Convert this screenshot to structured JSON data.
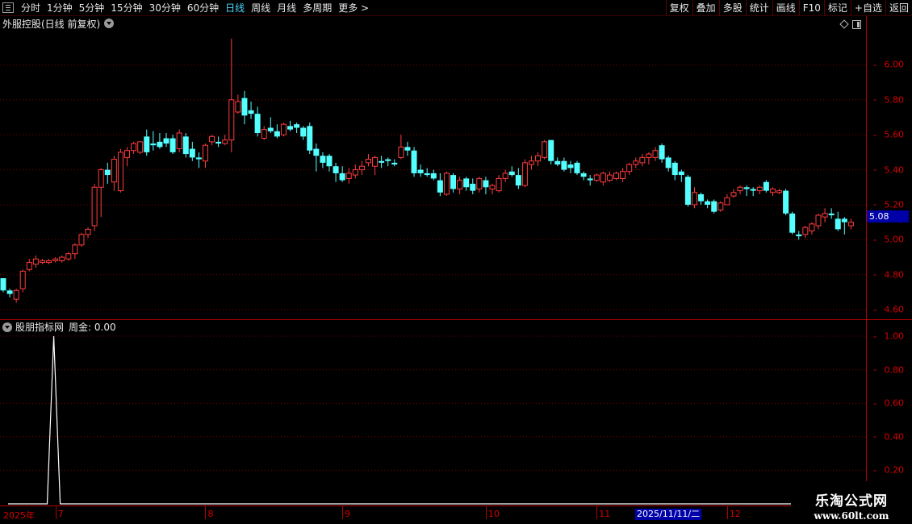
{
  "toolbar": {
    "periods": [
      {
        "label": "分时",
        "active": false
      },
      {
        "label": "1分钟",
        "active": false
      },
      {
        "label": "5分钟",
        "active": false
      },
      {
        "label": "15分钟",
        "active": false
      },
      {
        "label": "30分钟",
        "active": false
      },
      {
        "label": "60分钟",
        "active": false
      },
      {
        "label": "日线",
        "active": true
      },
      {
        "label": "周线",
        "active": false
      },
      {
        "label": "月线",
        "active": false
      },
      {
        "label": "多周期",
        "active": false
      },
      {
        "label": "更多 >",
        "active": false
      }
    ],
    "actions": [
      "复权",
      "叠加",
      "多股",
      "统计",
      "画线",
      "F10",
      "标记",
      "+自选",
      "返回"
    ]
  },
  "stock": {
    "title": "外服控股(日线 前复权)",
    "current_price": "5.08"
  },
  "indicator": {
    "name": "股朋指标网",
    "line_label": "周金: 0.00"
  },
  "dates": {
    "labels": [
      "2025年",
      "7",
      "8",
      "9",
      "10",
      "11",
      "12"
    ],
    "highlight": "2025/11/11/二"
  },
  "watermark": {
    "line1": "乐淘公式网",
    "line2": "www.60lt.com"
  },
  "colors": {
    "up": "#ff3c3c",
    "down": "#54ffff",
    "axis": "#d80000",
    "grid": "#7a0000",
    "indicator_line": "#ffffff"
  },
  "chart_data": [
    {
      "type": "candlestick",
      "title": "外服控股(日线 前复权)",
      "ylim": [
        4.55,
        6.2
      ],
      "yticks": [
        "6.00",
        "5.80",
        "5.60",
        "5.40",
        "5.20",
        "5.00",
        "4.80",
        "4.60"
      ],
      "ohlc": [
        [
          4.78,
          4.78,
          4.7,
          4.71
        ],
        [
          4.71,
          4.72,
          4.67,
          4.69
        ],
        [
          4.66,
          4.72,
          4.64,
          4.71
        ],
        [
          4.72,
          4.83,
          4.7,
          4.82
        ],
        [
          4.83,
          4.89,
          4.82,
          4.87
        ],
        [
          4.86,
          4.91,
          4.84,
          4.89
        ],
        [
          4.87,
          4.89,
          4.86,
          4.88
        ],
        [
          4.87,
          4.89,
          4.86,
          4.88
        ],
        [
          4.88,
          4.9,
          4.87,
          4.89
        ],
        [
          4.88,
          4.91,
          4.87,
          4.9
        ],
        [
          4.89,
          4.93,
          4.88,
          4.92
        ],
        [
          4.92,
          4.98,
          4.89,
          4.97
        ],
        [
          4.97,
          5.04,
          4.96,
          5.03
        ],
        [
          5.03,
          5.07,
          5.01,
          5.06
        ],
        [
          5.08,
          5.32,
          5.05,
          5.3
        ],
        [
          5.3,
          5.41,
          5.13,
          5.4
        ],
        [
          5.4,
          5.44,
          5.32,
          5.37
        ],
        [
          5.33,
          5.48,
          5.28,
          5.46
        ],
        [
          5.28,
          5.52,
          5.27,
          5.5
        ],
        [
          5.47,
          5.53,
          5.42,
          5.51
        ],
        [
          5.51,
          5.56,
          5.49,
          5.55
        ],
        [
          5.5,
          5.56,
          5.49,
          5.56
        ],
        [
          5.59,
          5.63,
          5.48,
          5.5
        ],
        [
          5.55,
          5.62,
          5.51,
          5.54
        ],
        [
          5.56,
          5.61,
          5.52,
          5.53
        ],
        [
          5.58,
          5.61,
          5.53,
          5.55
        ],
        [
          5.58,
          5.6,
          5.49,
          5.5
        ],
        [
          5.52,
          5.63,
          5.5,
          5.61
        ],
        [
          5.59,
          5.61,
          5.47,
          5.49
        ],
        [
          5.52,
          5.56,
          5.45,
          5.47
        ],
        [
          5.47,
          5.5,
          5.41,
          5.46
        ],
        [
          5.45,
          5.55,
          5.41,
          5.54
        ],
        [
          5.56,
          5.6,
          5.54,
          5.59
        ],
        [
          5.56,
          5.59,
          5.53,
          5.55
        ],
        [
          5.55,
          5.6,
          5.54,
          5.57
        ],
        [
          5.57,
          6.15,
          5.5,
          5.8
        ],
        [
          5.73,
          5.83,
          5.72,
          5.79
        ],
        [
          5.81,
          5.85,
          5.66,
          5.71
        ],
        [
          5.74,
          5.79,
          5.69,
          5.72
        ],
        [
          5.72,
          5.76,
          5.59,
          5.61
        ],
        [
          5.58,
          5.65,
          5.57,
          5.63
        ],
        [
          5.64,
          5.7,
          5.61,
          5.62
        ],
        [
          5.62,
          5.66,
          5.58,
          5.59
        ],
        [
          5.6,
          5.67,
          5.59,
          5.66
        ],
        [
          5.65,
          5.68,
          5.62,
          5.63
        ],
        [
          5.66,
          5.67,
          5.61,
          5.64
        ],
        [
          5.64,
          5.65,
          5.57,
          5.59
        ],
        [
          5.65,
          5.67,
          5.49,
          5.51
        ],
        [
          5.52,
          5.55,
          5.39,
          5.48
        ],
        [
          5.48,
          5.5,
          5.41,
          5.44
        ],
        [
          5.48,
          5.49,
          5.39,
          5.42
        ],
        [
          5.42,
          5.44,
          5.33,
          5.38
        ],
        [
          5.38,
          5.42,
          5.33,
          5.34
        ],
        [
          5.35,
          5.41,
          5.32,
          5.38
        ],
        [
          5.37,
          5.43,
          5.35,
          5.4
        ],
        [
          5.4,
          5.45,
          5.37,
          5.42
        ],
        [
          5.44,
          5.49,
          5.42,
          5.46
        ],
        [
          5.42,
          5.48,
          5.37,
          5.47
        ],
        [
          5.45,
          5.48,
          5.41,
          5.44
        ],
        [
          5.46,
          5.47,
          5.42,
          5.45
        ],
        [
          5.44,
          5.46,
          5.42,
          5.43
        ],
        [
          5.47,
          5.6,
          5.46,
          5.53
        ],
        [
          5.53,
          5.56,
          5.48,
          5.51
        ],
        [
          5.51,
          5.53,
          5.36,
          5.38
        ],
        [
          5.4,
          5.43,
          5.36,
          5.38
        ],
        [
          5.38,
          5.41,
          5.36,
          5.37
        ],
        [
          5.38,
          5.4,
          5.34,
          5.35
        ],
        [
          5.34,
          5.38,
          5.25,
          5.27
        ],
        [
          5.26,
          5.39,
          5.25,
          5.38
        ],
        [
          5.37,
          5.38,
          5.27,
          5.29
        ],
        [
          5.29,
          5.36,
          5.26,
          5.34
        ],
        [
          5.35,
          5.36,
          5.28,
          5.3
        ],
        [
          5.32,
          5.35,
          5.26,
          5.28
        ],
        [
          5.29,
          5.36,
          5.27,
          5.35
        ],
        [
          5.34,
          5.36,
          5.26,
          5.3
        ],
        [
          5.29,
          5.32,
          5.26,
          5.31
        ],
        [
          5.28,
          5.37,
          5.27,
          5.35
        ],
        [
          5.35,
          5.4,
          5.33,
          5.38
        ],
        [
          5.39,
          5.42,
          5.36,
          5.37
        ],
        [
          5.37,
          5.41,
          5.29,
          5.31
        ],
        [
          5.31,
          5.46,
          5.3,
          5.44
        ],
        [
          5.43,
          5.48,
          5.4,
          5.45
        ],
        [
          5.45,
          5.5,
          5.42,
          5.48
        ],
        [
          5.47,
          5.57,
          5.46,
          5.56
        ],
        [
          5.57,
          5.57,
          5.43,
          5.45
        ],
        [
          5.45,
          5.47,
          5.42,
          5.43
        ],
        [
          5.45,
          5.47,
          5.39,
          5.4
        ],
        [
          5.43,
          5.45,
          5.38,
          5.41
        ],
        [
          5.44,
          5.45,
          5.37,
          5.38
        ],
        [
          5.38,
          5.39,
          5.34,
          5.36
        ],
        [
          5.35,
          5.37,
          5.31,
          5.34
        ],
        [
          5.34,
          5.38,
          5.33,
          5.37
        ],
        [
          5.33,
          5.39,
          5.31,
          5.38
        ],
        [
          5.34,
          5.39,
          5.33,
          5.37
        ],
        [
          5.35,
          5.39,
          5.34,
          5.38
        ],
        [
          5.35,
          5.41,
          5.33,
          5.39
        ],
        [
          5.39,
          5.44,
          5.37,
          5.43
        ],
        [
          5.43,
          5.47,
          5.41,
          5.45
        ],
        [
          5.44,
          5.49,
          5.42,
          5.47
        ],
        [
          5.47,
          5.5,
          5.43,
          5.49
        ],
        [
          5.47,
          5.53,
          5.45,
          5.51
        ],
        [
          5.54,
          5.55,
          5.44,
          5.46
        ],
        [
          5.47,
          5.48,
          5.39,
          5.41
        ],
        [
          5.44,
          5.45,
          5.34,
          5.37
        ],
        [
          5.39,
          5.4,
          5.33,
          5.37
        ],
        [
          5.36,
          5.37,
          5.19,
          5.2
        ],
        [
          5.2,
          5.3,
          5.18,
          5.27
        ],
        [
          5.26,
          5.27,
          5.2,
          5.22
        ],
        [
          5.22,
          5.23,
          5.18,
          5.2
        ],
        [
          5.22,
          5.23,
          5.15,
          5.16
        ],
        [
          5.17,
          5.22,
          5.16,
          5.21
        ],
        [
          5.2,
          5.26,
          5.2,
          5.24
        ],
        [
          5.25,
          5.29,
          5.24,
          5.27
        ],
        [
          5.28,
          5.31,
          5.26,
          5.3
        ],
        [
          5.3,
          5.31,
          5.25,
          5.29
        ],
        [
          5.29,
          5.3,
          5.25,
          5.28
        ],
        [
          5.28,
          5.31,
          5.26,
          5.3
        ],
        [
          5.33,
          5.34,
          5.27,
          5.28
        ],
        [
          5.27,
          5.3,
          5.25,
          5.29
        ],
        [
          5.27,
          5.29,
          5.26,
          5.28
        ],
        [
          5.28,
          5.29,
          5.14,
          5.15
        ],
        [
          5.15,
          5.16,
          5.03,
          5.04
        ],
        [
          5.03,
          5.05,
          5.0,
          5.02
        ],
        [
          5.03,
          5.08,
          5.01,
          5.07
        ],
        [
          5.05,
          5.1,
          5.03,
          5.09
        ],
        [
          5.08,
          5.15,
          5.06,
          5.14
        ],
        [
          5.13,
          5.18,
          5.1,
          5.15
        ],
        [
          5.15,
          5.18,
          5.12,
          5.14
        ],
        [
          5.12,
          5.16,
          5.05,
          5.06
        ],
        [
          5.12,
          5.13,
          5.03,
          5.1
        ],
        [
          5.08,
          5.12,
          5.06,
          5.1
        ]
      ]
    },
    {
      "type": "line",
      "title": "股朋指标网",
      "series": [
        {
          "name": "周金",
          "values": [
            0,
            0,
            0,
            0,
            0,
            0,
            0,
            1,
            0,
            0,
            0,
            0,
            0,
            0,
            0,
            0,
            0,
            0,
            0,
            0,
            0,
            0,
            0,
            0,
            0,
            0,
            0,
            0,
            0,
            0,
            0,
            0,
            0,
            0,
            0,
            0,
            0,
            0,
            0,
            0,
            0,
            0,
            0,
            0,
            0,
            0,
            0,
            0,
            0,
            0,
            0,
            0,
            0,
            0,
            0,
            0,
            0,
            0,
            0,
            0,
            0,
            0,
            0,
            0,
            0,
            0,
            0,
            0,
            0,
            0,
            0,
            0,
            0,
            0,
            0,
            0,
            0,
            0,
            0,
            0,
            0,
            0,
            0,
            0,
            0,
            0,
            0,
            0,
            0,
            0,
            0,
            0,
            0,
            0,
            0,
            0,
            0,
            0,
            0,
            0,
            0,
            0,
            0,
            0,
            0,
            0,
            0,
            0,
            0,
            0,
            0,
            0,
            0,
            0,
            0,
            0,
            0,
            0,
            0,
            0,
            0,
            0,
            0,
            0,
            0,
            0,
            0,
            0,
            0,
            0,
            0
          ]
        }
      ],
      "ylim": [
        0,
        1.0
      ],
      "yticks": [
        "1.00",
        "0.80",
        "0.60",
        "0.40",
        "0.20"
      ]
    }
  ]
}
